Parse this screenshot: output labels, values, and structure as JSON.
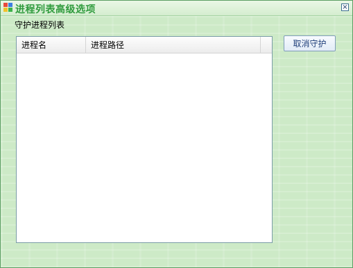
{
  "window": {
    "title": "进程列表高级选项",
    "close_glyph": "×"
  },
  "group": {
    "label": "守护进程列表"
  },
  "list": {
    "columns": [
      "进程名",
      "进程路径",
      ""
    ],
    "rows": []
  },
  "buttons": {
    "cancel_guard": "取消守护"
  },
  "colors": {
    "title_text": "#2f9b3d",
    "background": "#cdeac7",
    "button_text": "#1f3f7a"
  }
}
